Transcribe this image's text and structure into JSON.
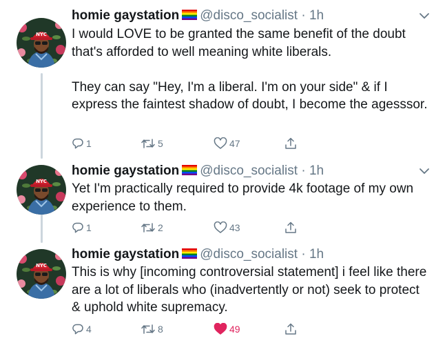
{
  "tweets": [
    {
      "name": "homie gaystation",
      "handle": "@disco_socialist",
      "time": "1h",
      "text": "I would LOVE to be granted the same benefit of the doubt that's afforded to well meaning white liberals.\n\nThey can say \"Hey, I'm a liberal. I'm on your side\" & if I express the faintest shadow of doubt, I become the agesssor.",
      "replies": "1",
      "retweets": "5",
      "likes": "47",
      "liked": false
    },
    {
      "name": "homie gaystation",
      "handle": "@disco_socialist",
      "time": "1h",
      "text": "Yet I'm practically required to provide 4k footage of my own experience to them.",
      "replies": "1",
      "retweets": "2",
      "likes": "43",
      "liked": false
    },
    {
      "name": "homie gaystation",
      "handle": "@disco_socialist",
      "time": "1h",
      "text": "This is why [incoming controversial statement] i feel like there are a lot of liberals who (inadvertently or not) seek to protect & uphold white supremacy.",
      "replies": "4",
      "retweets": "8",
      "likes": "49",
      "liked": true
    }
  ],
  "separator": " · ",
  "icons": {
    "reply": "reply-icon",
    "retweet": "retweet-icon",
    "like": "heart-icon",
    "share": "share-icon",
    "more": "chevron-down-icon",
    "flag": "rainbow-flag-icon"
  },
  "colors": {
    "text": "#14171a",
    "secondary": "#657786",
    "like_active": "#e0245e",
    "thread_line": "#ccd6dd"
  }
}
